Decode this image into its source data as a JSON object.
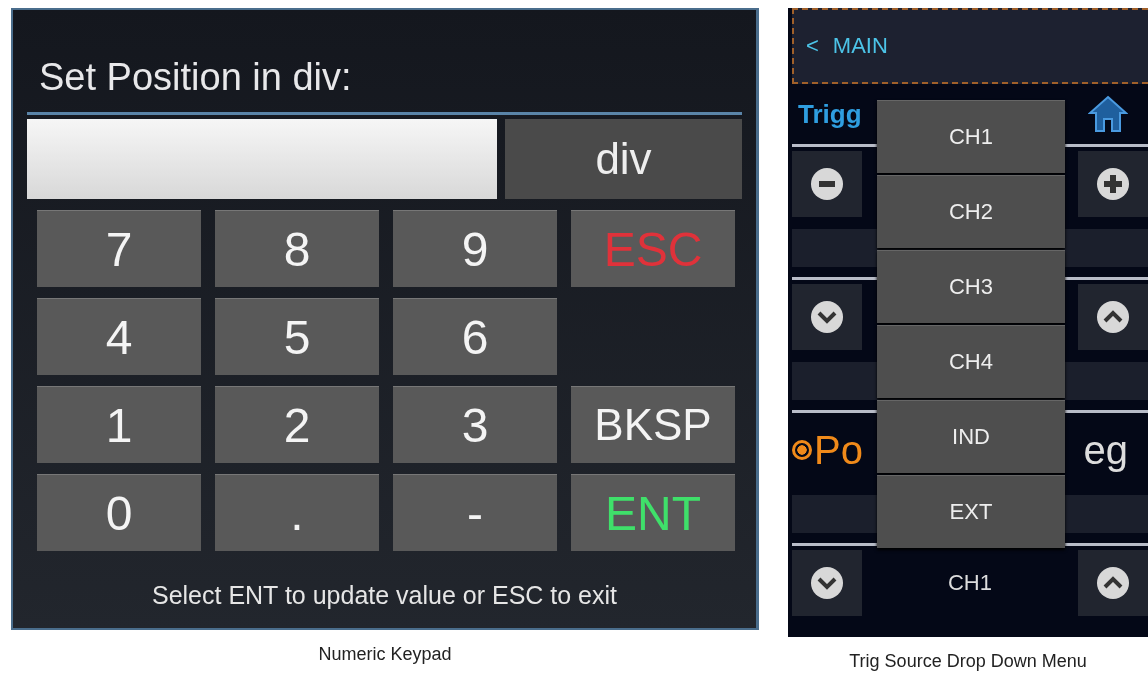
{
  "keypad": {
    "title": "Set Position in div:",
    "unit_button": "div",
    "keys": [
      {
        "kind": "digit",
        "label": "7"
      },
      {
        "kind": "digit",
        "label": "8"
      },
      {
        "kind": "digit",
        "label": "9"
      },
      {
        "kind": "cancel",
        "label": "ESC"
      },
      {
        "kind": "digit",
        "label": "4"
      },
      {
        "kind": "digit",
        "label": "5"
      },
      {
        "kind": "digit",
        "label": "6"
      },
      {
        "kind": "empty"
      },
      {
        "kind": "digit",
        "label": "1"
      },
      {
        "kind": "digit",
        "label": "2"
      },
      {
        "kind": "digit",
        "label": "3"
      },
      {
        "kind": "backspace",
        "label": "BKSP"
      },
      {
        "kind": "digit",
        "label": "0"
      },
      {
        "kind": "digit",
        "label": "."
      },
      {
        "kind": "digit",
        "label": "-"
      },
      {
        "kind": "enter",
        "label": "ENT"
      }
    ],
    "hint": "Select ENT to update value or ESC to exit",
    "caption": "Numeric Keypad"
  },
  "trigger": {
    "back": {
      "arrow": "<",
      "label": "MAIN"
    },
    "header": "Trigg",
    "rows": [
      {
        "kind": "stepper"
      },
      {
        "kind": "chevrons"
      },
      {
        "kind": "radio",
        "checked": true,
        "left": "Po",
        "right": "eg"
      },
      {
        "kind": "chevrons",
        "value": "CH1"
      }
    ],
    "menu": [
      "CH1",
      "CH2",
      "CH3",
      "CH4",
      "IND",
      "EXT"
    ],
    "caption": "Trig Source Drop Down Menu"
  }
}
